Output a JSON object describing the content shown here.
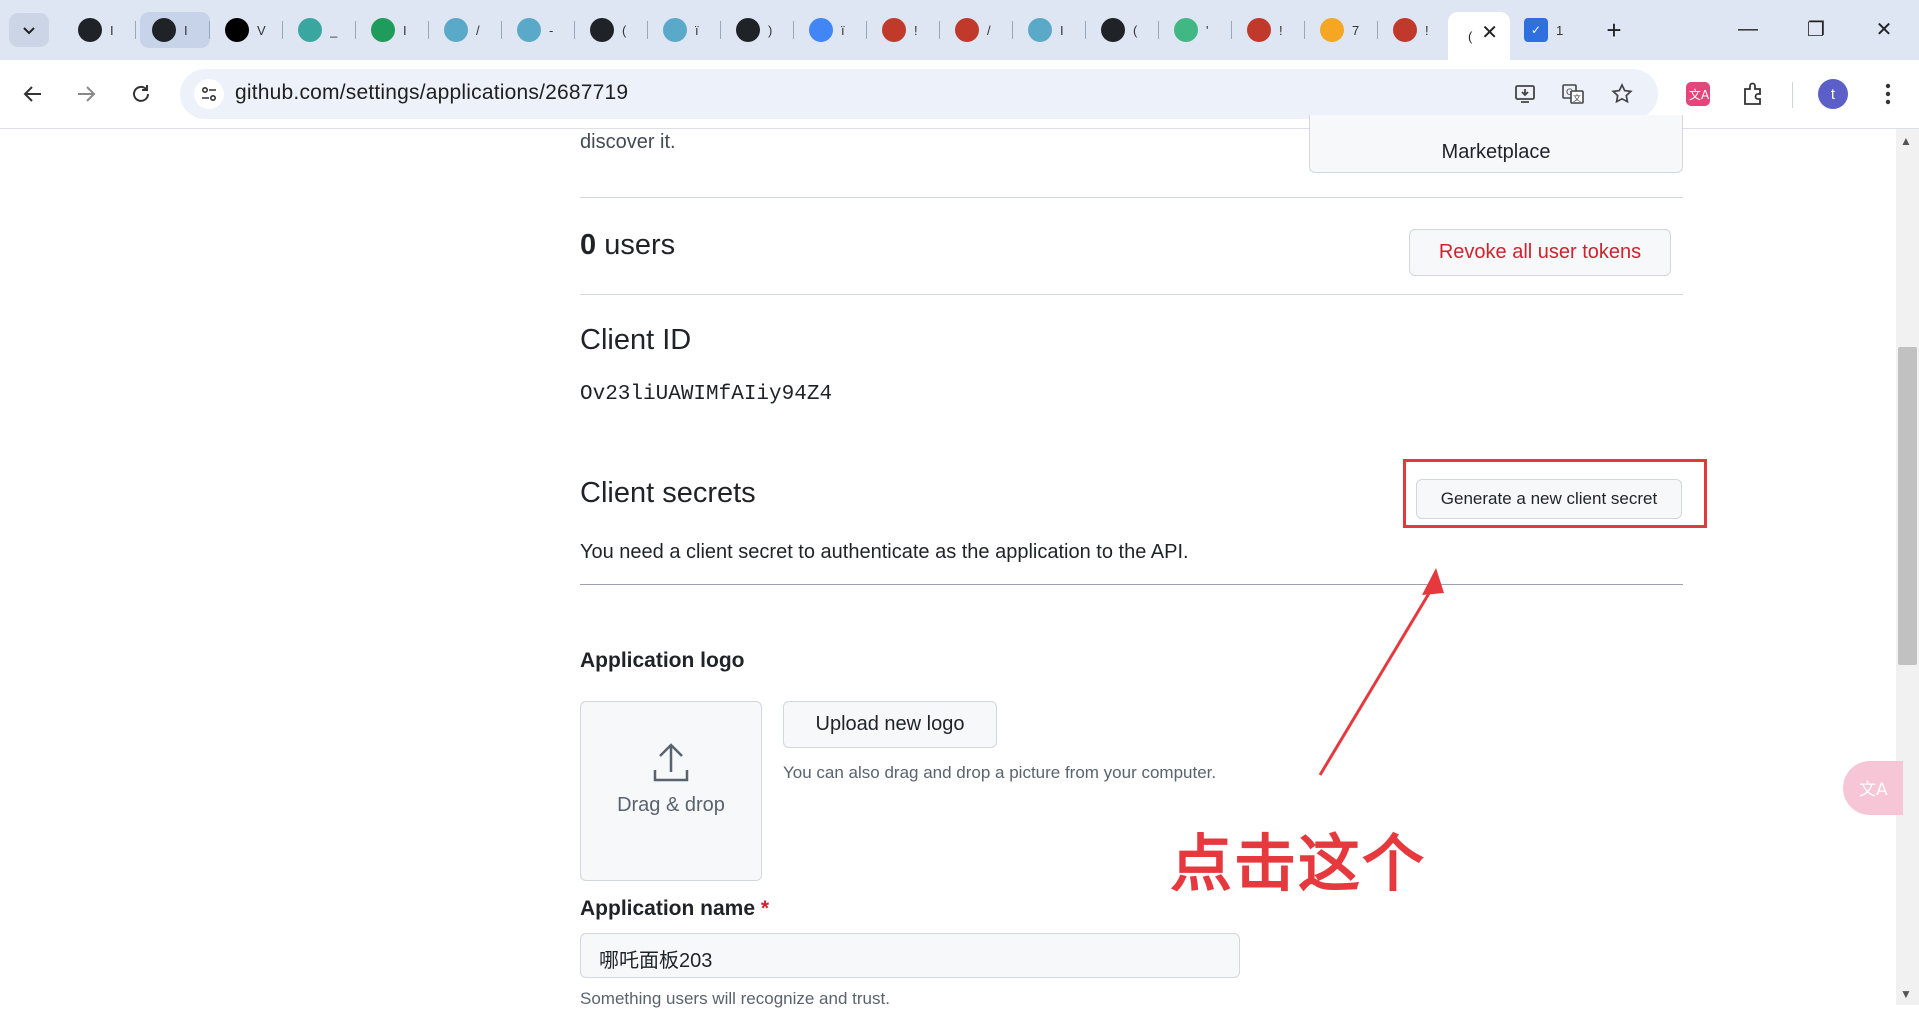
{
  "browser": {
    "tabs": [
      {
        "icon": "github-icon",
        "char": "I",
        "color": "#1f2328"
      },
      {
        "icon": "github-icon",
        "char": "I",
        "color": "#1f2328"
      },
      {
        "icon": "triangle-logo-icon",
        "char": "V",
        "color": "#000000"
      },
      {
        "icon": "p-logo-icon",
        "char": "_",
        "color": "#3aa6a0"
      },
      {
        "icon": "w-logo-icon",
        "char": "I",
        "color": "#1f9b5b"
      },
      {
        "icon": "mountain-logo-icon",
        "char": "/",
        "color": "#5aa9c9"
      },
      {
        "icon": "mountain-logo-icon",
        "char": "-",
        "color": "#5aa9c9"
      },
      {
        "icon": "github-icon",
        "char": "(",
        "color": "#1f2328"
      },
      {
        "icon": "mountain-logo-icon",
        "char": "ï",
        "color": "#5aa9c9"
      },
      {
        "icon": "github-icon",
        "char": ")",
        "color": "#1f2328"
      },
      {
        "icon": "google-icon",
        "char": "ï",
        "color": "#4285f4"
      },
      {
        "icon": "dw-logo-icon",
        "char": "!",
        "color": "#c0392b"
      },
      {
        "icon": "dw-logo-icon",
        "char": "/",
        "color": "#c0392b"
      },
      {
        "icon": "mountain-logo-icon",
        "char": "I",
        "color": "#5aa9c9"
      },
      {
        "icon": "github-icon",
        "char": "(",
        "color": "#1f2328"
      },
      {
        "icon": "vue-logo-icon",
        "char": "'",
        "color": "#41b883"
      },
      {
        "icon": "dw-logo-icon",
        "char": "!",
        "color": "#c0392b"
      },
      {
        "icon": "orange-logo-icon",
        "char": "7",
        "color": "#f5a623"
      },
      {
        "icon": "dw-logo-icon",
        "char": "!",
        "color": "#c0392b"
      }
    ],
    "active_tab": {
      "char": "("
    },
    "extra_tab": {
      "icon": "shield-logo-icon",
      "char": "1"
    },
    "url": "github.com/settings/applications/2687719"
  },
  "page": {
    "partial_text": "discover it.",
    "marketplace_button": "Marketplace",
    "users_count": "0",
    "users_label": "users",
    "revoke_button": "Revoke all user tokens",
    "client_id_title": "Client ID",
    "client_id_value": "Ov23liUAWIMfAIiy94Z4",
    "client_secrets_title": "Client secrets",
    "generate_secret_button": "Generate a new client secret",
    "client_secrets_desc": "You need a client secret to authenticate as the application to the API.",
    "app_logo_label": "Application logo",
    "drag_drop_label": "Drag & drop",
    "upload_logo_button": "Upload new logo",
    "upload_hint": "You can also drag and drop a picture from your computer.",
    "app_name_label": "Application name",
    "required_mark": "*",
    "app_name_value": "哪吒面板203",
    "app_name_hint": "Something users will recognize and trust."
  },
  "annotation": {
    "text": "点击这个",
    "color": "#e5393e"
  },
  "colors": {
    "danger": "#cf222e",
    "border": "#d0d7de",
    "button_bg": "#f6f8fa"
  }
}
